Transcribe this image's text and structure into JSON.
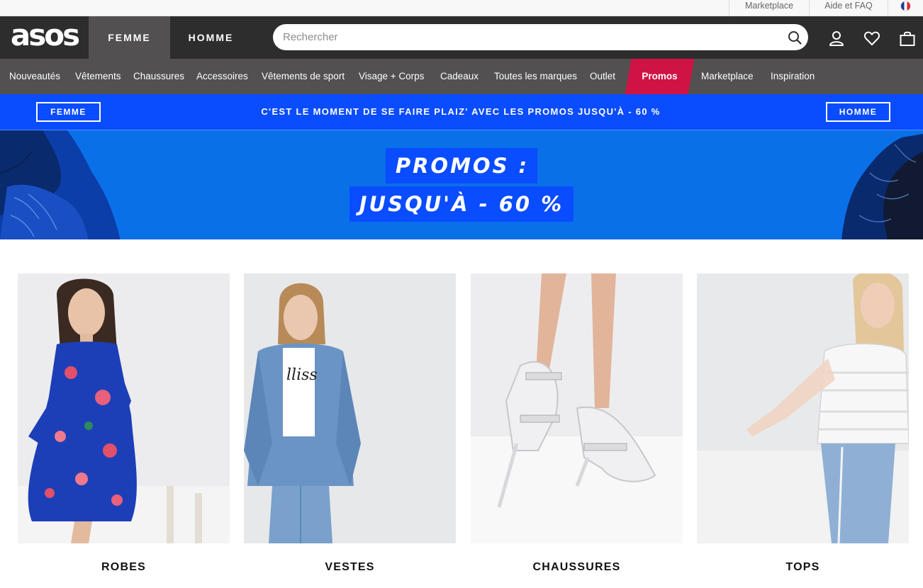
{
  "utility": {
    "marketplace": "Marketplace",
    "help": "Aide et FAQ",
    "flag_icon": "france-flag-icon"
  },
  "header": {
    "logo": "asos",
    "tabs": [
      {
        "label": "FEMME",
        "active": true
      },
      {
        "label": "HOMME",
        "active": false
      }
    ],
    "search": {
      "placeholder": "Rechercher",
      "value": ""
    },
    "icons": [
      "search-icon",
      "account-icon",
      "heart-icon",
      "bag-icon"
    ]
  },
  "nav": {
    "items": [
      {
        "label": "Nouveautés"
      },
      {
        "label": "Vêtements"
      },
      {
        "label": "Chaussures"
      },
      {
        "label": "Accessoires"
      },
      {
        "label": "Vêtements de sport"
      },
      {
        "label": "Visage + Corps"
      },
      {
        "label": "Cadeaux"
      },
      {
        "label": "Toutes les marques"
      },
      {
        "label": "Outlet"
      },
      {
        "label": "Promos"
      },
      {
        "label": "Marketplace"
      },
      {
        "label": "Inspiration"
      }
    ]
  },
  "strip": {
    "left_button": "FEMME",
    "text": "C'EST LE MOMENT DE SE FAIRE PLAIZ' AVEC LES PROMOS JUSQU'À - 60 %",
    "right_button": "HOMME"
  },
  "hero": {
    "line1": "PROMOS :",
    "line2": "JUSQU'À - 60 %"
  },
  "categories": [
    {
      "label": "ROBES"
    },
    {
      "label": "VESTES"
    },
    {
      "label": "CHAUSSURES"
    },
    {
      "label": "TOPS"
    }
  ],
  "colors": {
    "header_bg": "#2d2d2d",
    "nav_bg": "#525050",
    "promo_red": "#d01345",
    "strip_blue": "#0a4cff",
    "hero_blue": "#0a70e8"
  }
}
